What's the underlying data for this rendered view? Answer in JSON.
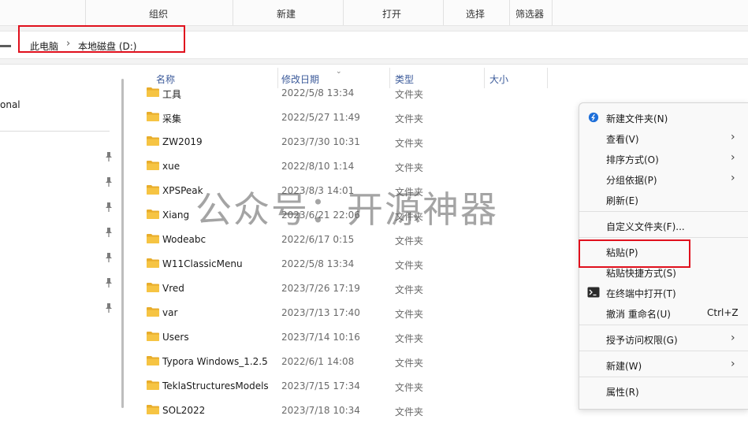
{
  "ribbon": {
    "group1": "组织",
    "group2": "新建",
    "group3": "打开",
    "group4": "选择",
    "group5": "筛选器"
  },
  "address": {
    "crumb1": "此电脑",
    "separator": "›",
    "crumb2": "本地磁盘 (D:)"
  },
  "nav": {
    "item_text": "onal"
  },
  "columns": {
    "name": "名称",
    "date": "修改日期",
    "type": "类型",
    "size": "大小"
  },
  "files": [
    {
      "name": "工具",
      "date": "2022/5/8 13:34",
      "type": "文件夹"
    },
    {
      "name": "采集",
      "date": "2022/5/27 11:49",
      "type": "文件夹"
    },
    {
      "name": "ZW2019",
      "date": "2023/7/30 10:31",
      "type": "文件夹"
    },
    {
      "name": "xue",
      "date": "2022/8/10 1:14",
      "type": "文件夹"
    },
    {
      "name": "XPSPeak",
      "date": "2023/8/3 14:01",
      "type": "文件夹"
    },
    {
      "name": "Xiang",
      "date": "2023/6/21 22:06",
      "type": "文件夹"
    },
    {
      "name": "Wodeabc",
      "date": "2022/6/17 0:15",
      "type": "文件夹"
    },
    {
      "name": "W11ClassicMenu",
      "date": "2022/5/8 13:34",
      "type": "文件夹"
    },
    {
      "name": "Vred",
      "date": "2023/7/26 17:19",
      "type": "文件夹"
    },
    {
      "name": "var",
      "date": "2023/7/13 17:40",
      "type": "文件夹"
    },
    {
      "name": "Users",
      "date": "2023/7/14 10:16",
      "type": "文件夹"
    },
    {
      "name": "Typora Windows_1.2.5",
      "date": "2022/6/1 14:08",
      "type": "文件夹"
    },
    {
      "name": "TeklaStructuresModels",
      "date": "2023/7/15 17:34",
      "type": "文件夹"
    },
    {
      "name": "SOL2022",
      "date": "2023/7/18 10:34",
      "type": "文件夹"
    }
  ],
  "watermark": "公众号：开源神器",
  "context_menu": {
    "new_folder": "新建文件夹(N)",
    "view": "查看(V)",
    "sort_by": "排序方式(O)",
    "group_by": "分组依据(P)",
    "refresh": "刷新(E)",
    "customize": "自定义文件夹(F)...",
    "paste": "粘贴(P)",
    "paste_shortcut": "粘贴快捷方式(S)",
    "open_terminal": "在终端中打开(T)",
    "undo_rename": "撤消 重命名(U)",
    "undo_shortcut": "Ctrl+Z",
    "grant_access": "授予访问权限(G)",
    "new": "新建(W)",
    "properties": "属性(R)",
    "submenu_arrow": "›"
  },
  "colors": {
    "highlight": "#e0101d",
    "folder": "#f6c443",
    "folder_dark": "#e8ad2b",
    "accent": "#1e6fd9"
  }
}
